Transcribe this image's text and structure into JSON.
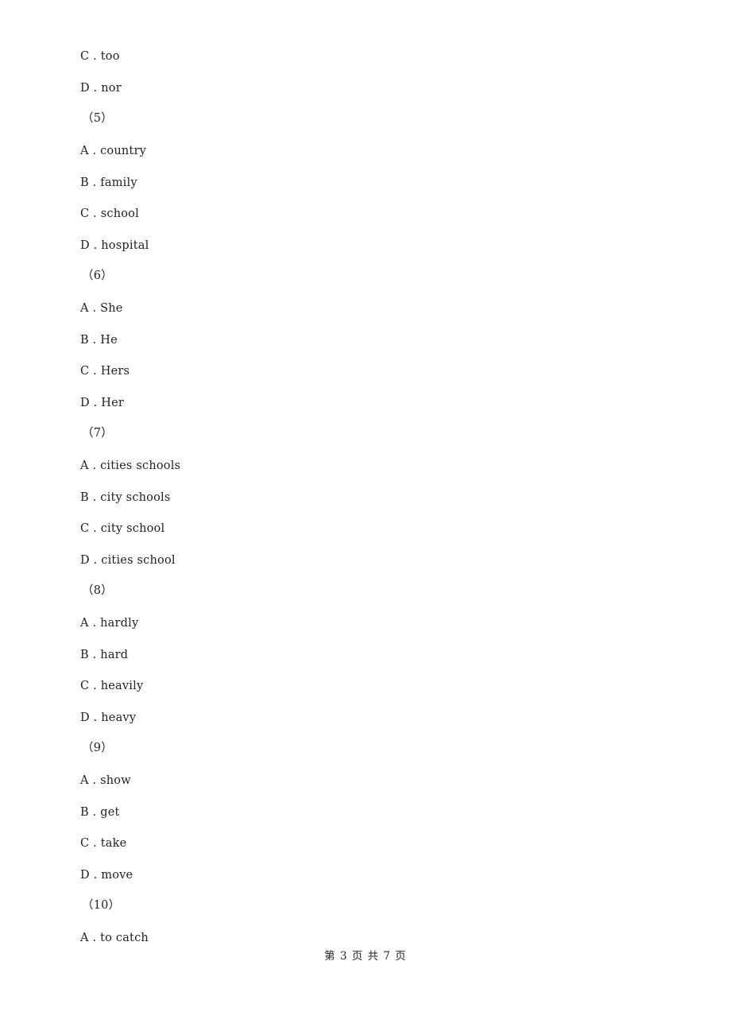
{
  "lines": [
    {
      "type": "option",
      "letter": "C",
      "text": "too"
    },
    {
      "type": "option",
      "letter": "D",
      "text": "nor"
    },
    {
      "type": "question",
      "text": "（5）"
    },
    {
      "type": "option",
      "letter": "A",
      "text": "country"
    },
    {
      "type": "option",
      "letter": "B",
      "text": "family"
    },
    {
      "type": "option",
      "letter": "C",
      "text": "school"
    },
    {
      "type": "option",
      "letter": "D",
      "text": "hospital"
    },
    {
      "type": "question",
      "text": "（6）"
    },
    {
      "type": "option",
      "letter": "A",
      "text": "She"
    },
    {
      "type": "option",
      "letter": "B",
      "text": "He"
    },
    {
      "type": "option",
      "letter": "C",
      "text": "Hers"
    },
    {
      "type": "option",
      "letter": "D",
      "text": "Her"
    },
    {
      "type": "question",
      "text": "（7）"
    },
    {
      "type": "option",
      "letter": "A",
      "text": "cities schools"
    },
    {
      "type": "option",
      "letter": "B",
      "text": "city schools"
    },
    {
      "type": "option",
      "letter": "C",
      "text": "city school"
    },
    {
      "type": "option",
      "letter": "D",
      "text": "cities school"
    },
    {
      "type": "question",
      "text": "（8）"
    },
    {
      "type": "option",
      "letter": "A",
      "text": "hardly"
    },
    {
      "type": "option",
      "letter": "B",
      "text": "hard"
    },
    {
      "type": "option",
      "letter": "C",
      "text": "heavily"
    },
    {
      "type": "option",
      "letter": "D",
      "text": "heavy"
    },
    {
      "type": "question",
      "text": "（9）"
    },
    {
      "type": "option",
      "letter": "A",
      "text": "show"
    },
    {
      "type": "option",
      "letter": "B",
      "text": "get"
    },
    {
      "type": "option",
      "letter": "C",
      "text": "take"
    },
    {
      "type": "option",
      "letter": "D",
      "text": "move"
    },
    {
      "type": "question",
      "text": "（10）"
    },
    {
      "type": "option",
      "letter": "A",
      "text": "to catch"
    }
  ],
  "footer": {
    "text": "第 3 页 共 7 页"
  }
}
